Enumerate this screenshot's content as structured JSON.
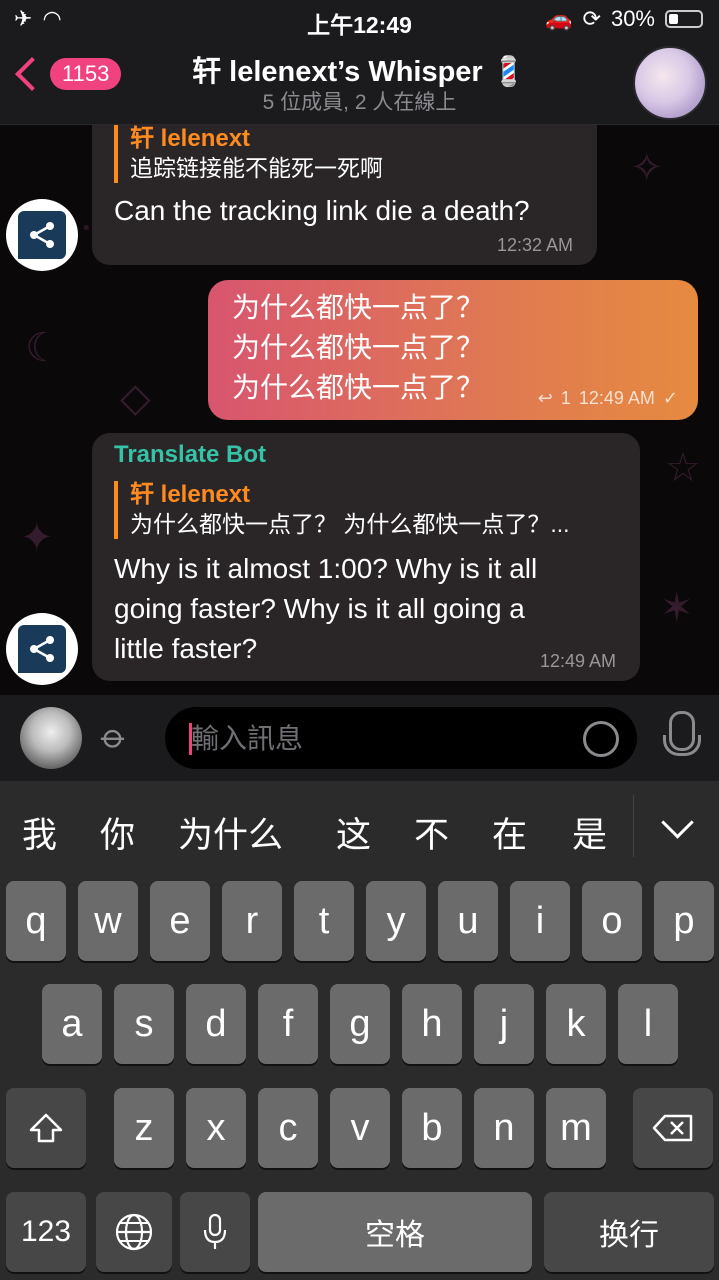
{
  "status": {
    "time": "上午12:49",
    "battery": "30%",
    "battery_level": 0.3
  },
  "header": {
    "back_count": "1153",
    "title": "轩 lelenext’s Whisper 💈",
    "subtitle": "5 位成員, 2 人在線上"
  },
  "messages": [
    {
      "reply_name": "轩 lelenext",
      "reply_text": "追踪链接能不能死一死啊",
      "text": "Can the tracking link die a death?",
      "time": "12:32 AM"
    },
    {
      "lines": [
        "为什么都快一点了？",
        "为什么都快一点了？",
        "为什么都快一点了？"
      ],
      "reply_count": "1",
      "time": "12:49 AM"
    },
    {
      "sender": "Translate Bot",
      "reply_name": "轩 lelenext",
      "reply_text": "为什么都快一点了？ 为什么都快一点了？...",
      "text_lines": [
        "Why is it almost 1:00? Why is it all",
        "going faster? Why is it all going a",
        "little faster?"
      ],
      "time": "12:49 AM"
    }
  ],
  "composer": {
    "placeholder": "輸入訊息"
  },
  "keyboard": {
    "candidates": [
      "我",
      "你",
      "为什么",
      "这",
      "不",
      "在",
      "是"
    ],
    "row1": [
      "q",
      "w",
      "e",
      "r",
      "t",
      "y",
      "u",
      "i",
      "o",
      "p"
    ],
    "row2": [
      "a",
      "s",
      "d",
      "f",
      "g",
      "h",
      "j",
      "k",
      "l"
    ],
    "row3": [
      "z",
      "x",
      "c",
      "v",
      "b",
      "n",
      "m"
    ],
    "num_label": "123",
    "space_label": "空格",
    "return_label": "换行"
  },
  "colors": {
    "accent": "#f0427e",
    "reply_orange": "#ff8a1f",
    "bot_green": "#35c2a7"
  },
  "icons": [
    "airplane-icon",
    "wifi-icon",
    "car-icon",
    "lock-rotation-icon",
    "battery-icon",
    "back-chevron-icon",
    "barber-pole-icon",
    "share-bot-icon",
    "paperclip-icon",
    "sticker-icon",
    "microphone-icon",
    "shift-icon",
    "backspace-icon",
    "globe-icon",
    "keyboard-mic-icon",
    "collapse-icon",
    "reply-arrow-icon",
    "read-check-icon"
  ]
}
